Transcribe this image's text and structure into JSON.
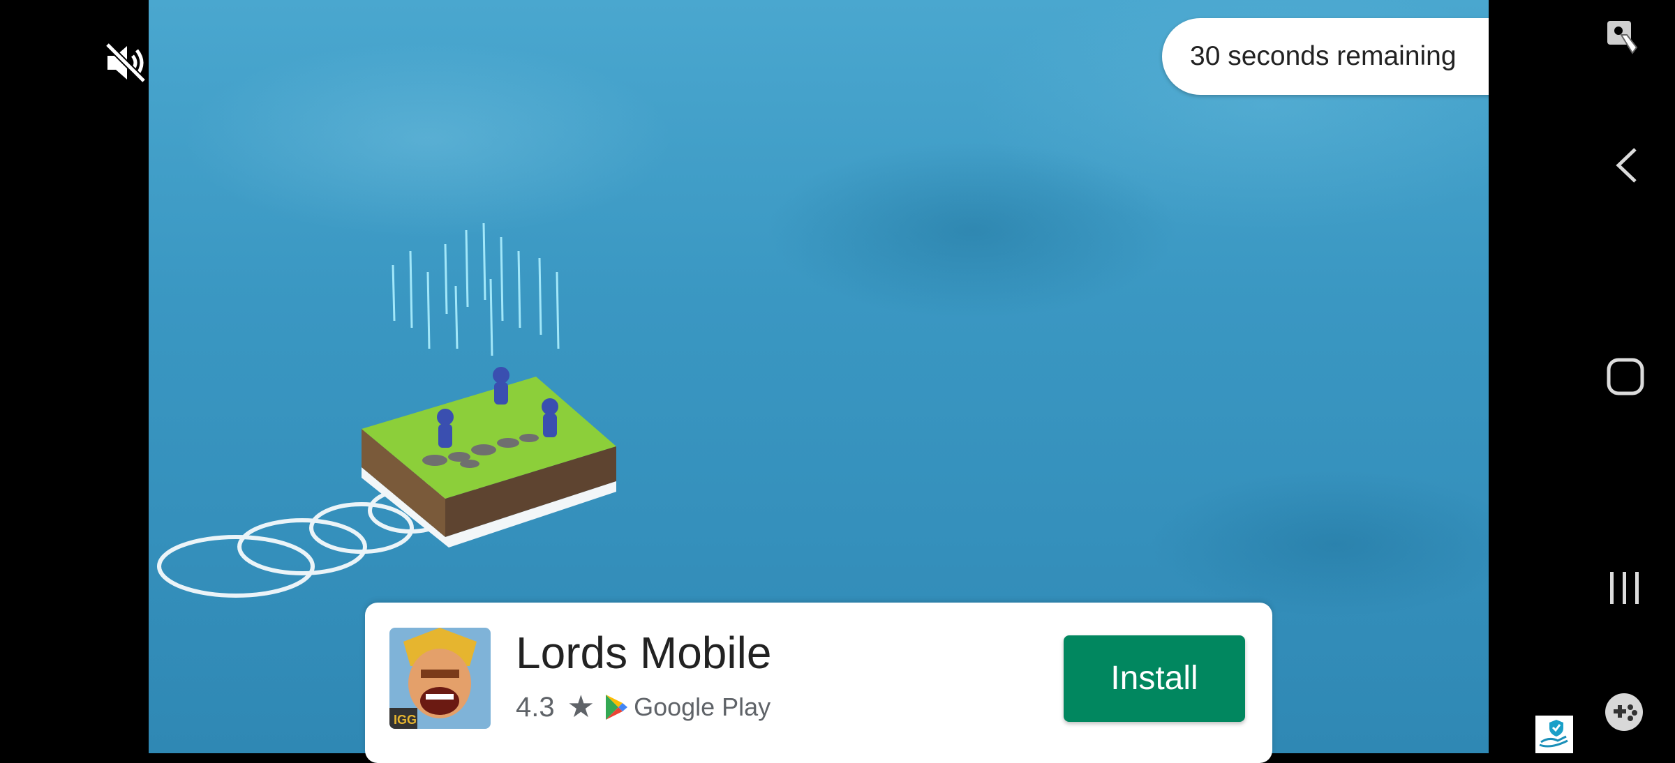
{
  "ad": {
    "timer_text": "30 seconds remaining",
    "mute_icon": "volume-off-icon",
    "close_icon": "close-icon"
  },
  "app": {
    "name": "Lords Mobile",
    "rating": "4.3",
    "store": "Google Play",
    "install_label": "Install",
    "icon": "lords-mobile-app-icon",
    "icon_badge": "IGG"
  },
  "navigation": {
    "items": [
      "screen-record-icon",
      "back-icon",
      "home-icon",
      "recents-icon",
      "game-launcher-icon"
    ]
  },
  "colors": {
    "install": "#01875f",
    "water": "#3a97c2"
  }
}
